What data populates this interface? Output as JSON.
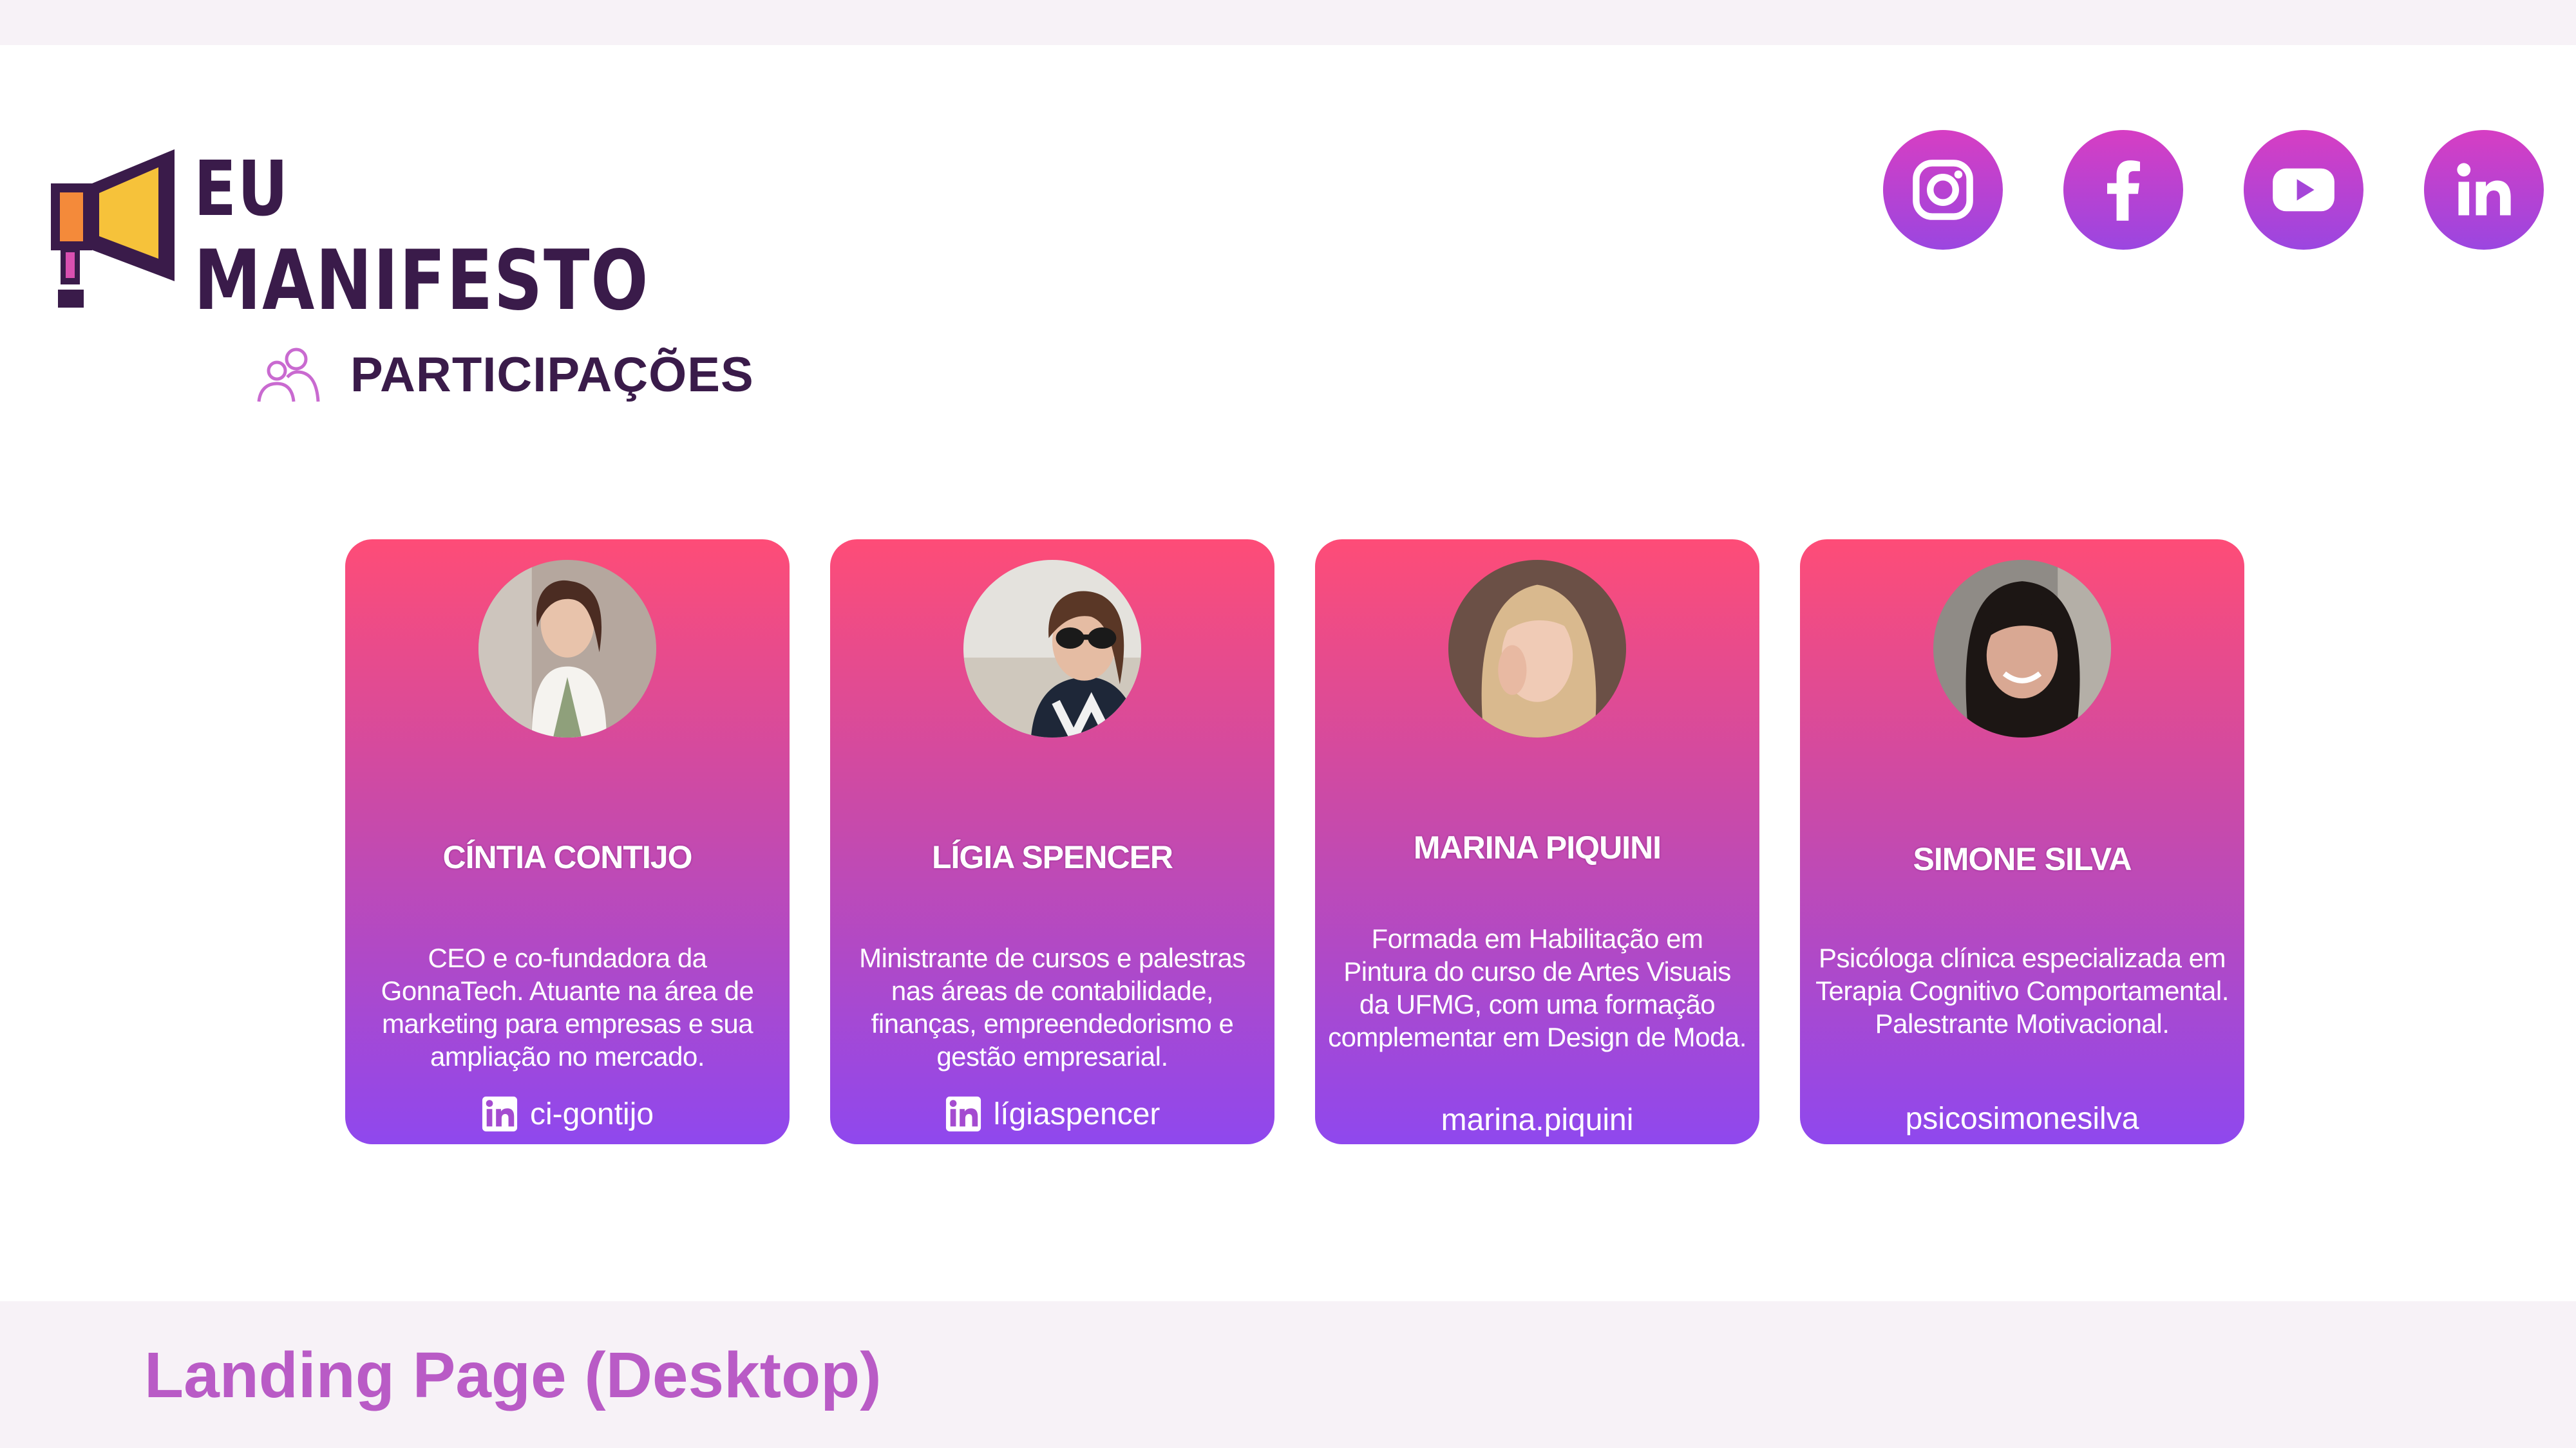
{
  "brand": {
    "logo_line1": "EU",
    "logo_line2": "MANIFESTO",
    "colors": {
      "dark": "#3a1b4a",
      "accent_pink": "#fe4c77",
      "accent_purple": "#8f48ee",
      "megaphone_orange": "#f48a3a",
      "megaphone_yellow": "#f6c23a"
    }
  },
  "social": [
    {
      "icon": "instagram-icon"
    },
    {
      "icon": "facebook-icon"
    },
    {
      "icon": "youtube-icon"
    },
    {
      "icon": "linkedin-icon"
    }
  ],
  "section": {
    "icon": "people-icon",
    "title": "PARTICIPAÇÕES"
  },
  "cards": [
    {
      "name": "CÍNTIA CONTIJO",
      "description": "CEO e co-fundadora da GonnaTech. Atuante na área de marketing para empresas e sua ampliação no mercado.",
      "handle": "ci-gontijo",
      "handle_icon": "linkedin-icon"
    },
    {
      "name": "LÍGIA SPENCER",
      "description": "Ministrante de cursos e palestras nas áreas de contabilidade, finanças, empreendedorismo e gestão empresarial.",
      "handle": "lígiaspencer",
      "handle_icon": "linkedin-icon"
    },
    {
      "name": "MARINA PIQUINI",
      "description": "Formada em Habilitação em Pintura do curso de Artes Visuais da UFMG, com uma formação complementar em Design de Moda.",
      "handle": "marina.piquini",
      "handle_icon": ""
    },
    {
      "name": "SIMONE SILVA",
      "description": "Psicóloga clínica especializada em Terapia Cognitivo Comportamental. Palestrante Motivacional.",
      "handle": "psicosimonesilva",
      "handle_icon": ""
    }
  ],
  "footer": {
    "label": "Landing Page (Desktop)"
  }
}
